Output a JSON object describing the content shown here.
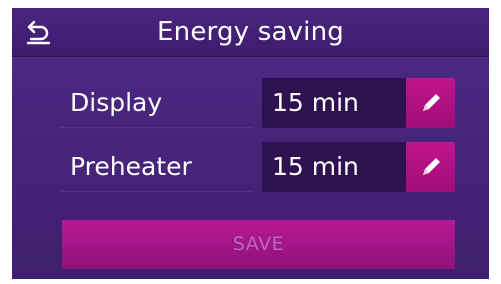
{
  "header": {
    "title": "Energy saving",
    "back_icon": "undo-arrow-icon"
  },
  "settings": [
    {
      "label": "Display",
      "value": "15 min",
      "edit_icon": "pencil-icon"
    },
    {
      "label": "Preheater",
      "value": "15 min",
      "edit_icon": "pencil-icon"
    }
  ],
  "actions": {
    "save_label": "SAVE"
  },
  "colors": {
    "background": "#46247a",
    "value_box": "#2e1250",
    "accent": "#c4148c",
    "save_text_disabled": "#b46ac0"
  }
}
